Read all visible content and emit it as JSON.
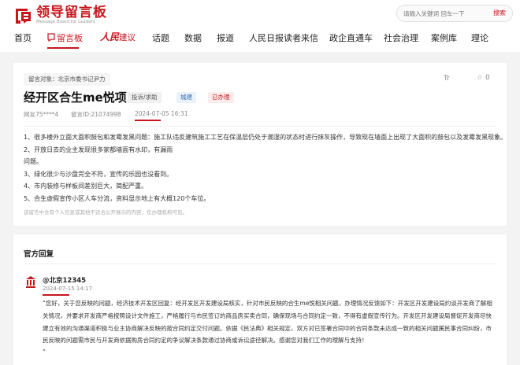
{
  "header": {
    "logo_title": "领导留言板",
    "logo_subtitle": "Message Board for Leaders",
    "search": {
      "placeholder": "请输入关键词 回车一下",
      "button_label": "搜索"
    }
  },
  "nav": {
    "items": [
      "首页",
      "留言板",
      "人民建议",
      "话题",
      "数据",
      "报道",
      "人民日报读者来信",
      "政企直通车",
      "社会治理",
      "案例库",
      "理论"
    ],
    "brand_script": "人民"
  },
  "message": {
    "target_label": "留言对象：",
    "target": "北京市委书记尹力",
    "title": "经开区合生me悦项目",
    "tags": {
      "type": "投诉/求助",
      "field": "城建",
      "status": "已办理"
    },
    "font_icon": "Tr",
    "favorite_count": "0",
    "user": "网友75****4",
    "id_label": "留言ID:",
    "id": "21074998",
    "datetime": "2024-07-05 16:31",
    "body": [
      "1、很多楼外立面大面积鼓包和发霉发黑问题：施工队违反建筑施工工艺在保温层仍处于潮湿的状态时进行抹灰操作，导致现在墙面上出现了大面积的鼓包以及发霉发黑现象。",
      "2、开放日去的业主发现很多家都墙面有水印，有漏雨",
      "问题。",
      "3、绿化很少与沙盘完全不符，宣传的乐园也没看到。",
      "4、市内装修与样板间差别巨大，简配严重。",
      "5、合生虚假宣传小区人车分流，资料显示地上有大概120个车位。"
    ],
    "disclaimer": "该留言中含有个人信息或其他不适合公开展示的内容，仅办理机构可见。"
  },
  "reply": {
    "section_title": "官方回复",
    "org": "@北京12345",
    "datetime": "2024-07-15 14:17",
    "lines": [
      "“您好，关于您反映的问题，经济技术开发区回复：经开发区开发建设局核实，针对市民反映的合生me悦相关问题，办理情况反馈如下：开发区开发建设局约谈开发商了解相",
      "关情况，并要求开发商严格按照设计文件施工，严格履行与市民签订的商品房买卖合同，确保现场与合同约定一致，不得有虚假宣传行为。开发区开发建设局督促开发商尽快",
      "建立有效的沟通渠道积极与业主协商解决反映的按合同约定交付问题。依据《民法典》相关规定，双方对已签署合同中的合同条款未达成一致的相关问题属民事合同纠纷，市",
      "民反映的问题需市民与开发商依据购房合同约定的争议解决条款通过协商或诉讼途径解决。感谢您对我们工作的理解与支持！",
      "”"
    ]
  },
  "colors": {
    "accent": "#c8161d",
    "link_blue": "#3b6fb5",
    "background": "#f3f3f3"
  },
  "icons": [
    "logo-mark-icon",
    "message-board-icon",
    "font-size-icon",
    "star-icon",
    "building-icon",
    "search-icon"
  ]
}
